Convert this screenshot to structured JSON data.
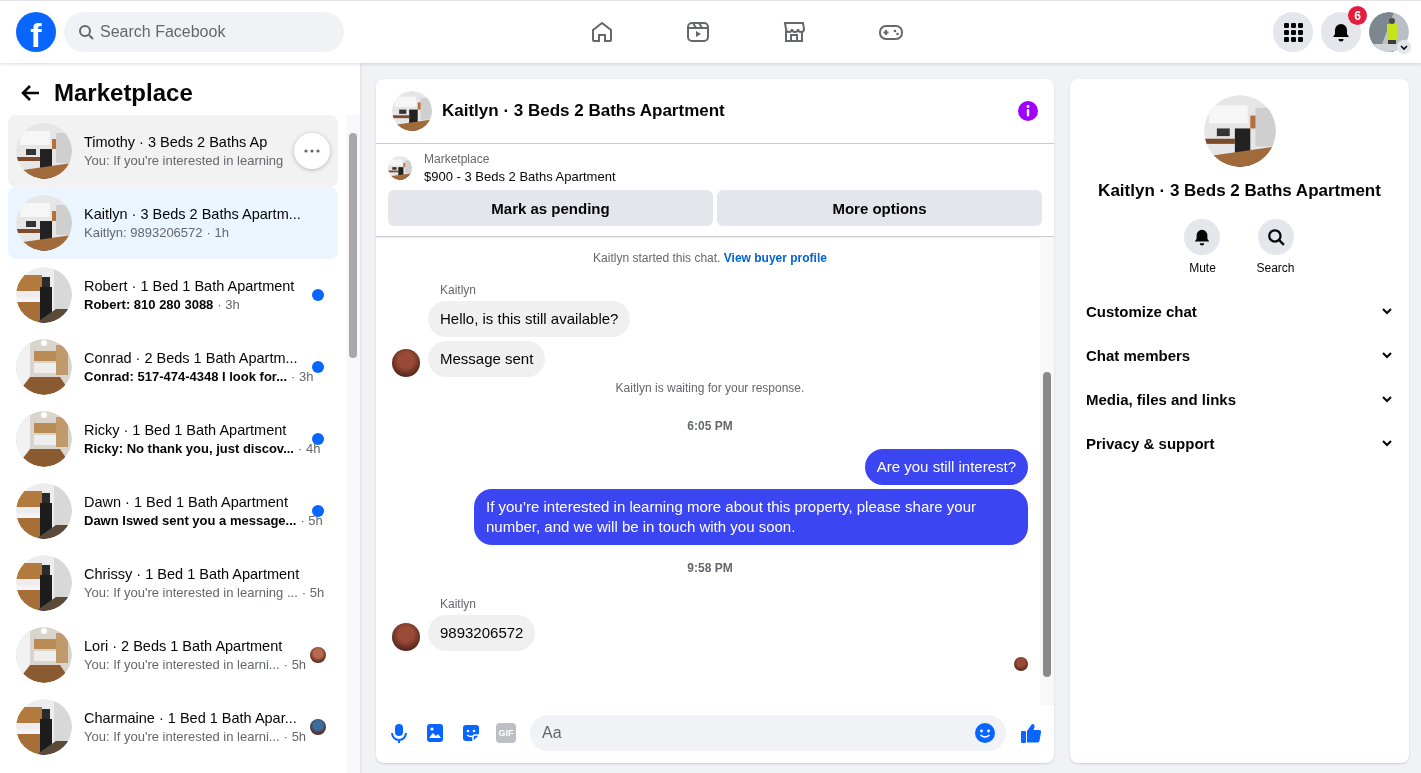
{
  "topbar": {
    "logo": "f",
    "search": {
      "placeholder": "Search Facebook"
    },
    "notifications_badge": "6"
  },
  "sidebar": {
    "title": "Marketplace",
    "conversations": [
      {
        "name": "Timothy · 3 Beds 2 Baths Ap",
        "snippet": "You: If you're interested in learning",
        "selected": false,
        "hovered": true,
        "unread": false,
        "seen_avatar": false
      },
      {
        "name": "Kaitlyn · 3 Beds 2 Baths Apartm...",
        "snippet": "Kaitlyn: 9893206572",
        "time": "· 1h",
        "selected": true,
        "hovered": false,
        "unread": false,
        "seen_avatar": false
      },
      {
        "name": "Robert · 1 Bed 1 Bath Apartment",
        "snippet": "Robert: 810 280 3088",
        "time": "· 3h",
        "selected": false,
        "hovered": false,
        "unread": true,
        "seen_avatar": false
      },
      {
        "name": "Conrad · 2 Beds 1 Bath Apartm...",
        "snippet": "Conrad: 517-474-4348 I look for...",
        "time": "· 3h",
        "selected": false,
        "hovered": false,
        "unread": true,
        "seen_avatar": false
      },
      {
        "name": "Ricky · 1 Bed 1 Bath Apartment",
        "snippet": "Ricky: No thank you, just discov...",
        "time": "· 4h",
        "selected": false,
        "hovered": false,
        "unread": true,
        "seen_avatar": false
      },
      {
        "name": "Dawn · 1 Bed 1 Bath Apartment",
        "snippet": "Dawn Iswed sent you a message...",
        "time": "· 5h",
        "selected": false,
        "hovered": false,
        "unread": true,
        "seen_avatar": false
      },
      {
        "name": "Chrissy · 1 Bed 1 Bath Apartment",
        "snippet": "You: If you're interested in learning ...",
        "time": "· 5h",
        "selected": false,
        "hovered": false,
        "unread": false,
        "seen_avatar": false
      },
      {
        "name": "Lori · 2 Beds 1 Bath Apartment",
        "snippet": "You: If you're interested in learni...",
        "time": "· 5h",
        "selected": false,
        "hovered": false,
        "unread": false,
        "seen_avatar": true
      },
      {
        "name": "Charmaine · 1 Bed 1 Bath Apar...",
        "snippet": "You: If you're interested in learni...",
        "time": "· 5h",
        "selected": false,
        "hovered": false,
        "unread": false,
        "seen_avatar": true
      }
    ]
  },
  "chat": {
    "title": "Kaitlyn · 3 Beds 2 Baths Apartment",
    "listing": {
      "source": "Marketplace",
      "title": "$900 - 3 Beds 2 Baths Apartment"
    },
    "buttons": [
      "Mark as pending",
      "More options"
    ],
    "messages": [
      {
        "kind": "system",
        "text": "Kaitlyn started this chat.",
        "link": "View buyer profile"
      },
      {
        "kind": "sender",
        "text": "Kaitlyn"
      },
      {
        "kind": "incoming",
        "text": "Hello, is this still available?",
        "avatar": false
      },
      {
        "kind": "incoming",
        "text": "Message sent",
        "avatar": true
      },
      {
        "kind": "system",
        "text": "Kaitlyn is waiting for your response."
      },
      {
        "kind": "timestamp",
        "text": "6:05 PM"
      },
      {
        "kind": "outgoing",
        "text": "Are you still interest?"
      },
      {
        "kind": "outgoing",
        "text": "If you’re interested in learning more about this property, please share your number, and we will be in touch with you soon."
      },
      {
        "kind": "timestamp",
        "text": "9:58 PM"
      },
      {
        "kind": "sender",
        "text": "Kaitlyn"
      },
      {
        "kind": "incoming",
        "text": "9893206572",
        "avatar": true
      },
      {
        "kind": "seen"
      }
    ],
    "composer": {
      "gif": "GIF",
      "placeholder": "Aa"
    }
  },
  "info": {
    "title": "Kaitlyn · 3 Beds 2 Baths Apartment",
    "actions": [
      {
        "kind": "mute",
        "label": "Mute"
      },
      {
        "kind": "search",
        "label": "Search"
      }
    ],
    "sections": [
      {
        "label": "Customize chat",
        "expanded": false
      },
      {
        "label": "Chat members",
        "expanded": false
      },
      {
        "label": "Media, files and links",
        "expanded": false
      },
      {
        "label": "Privacy & support",
        "expanded": false
      }
    ]
  }
}
